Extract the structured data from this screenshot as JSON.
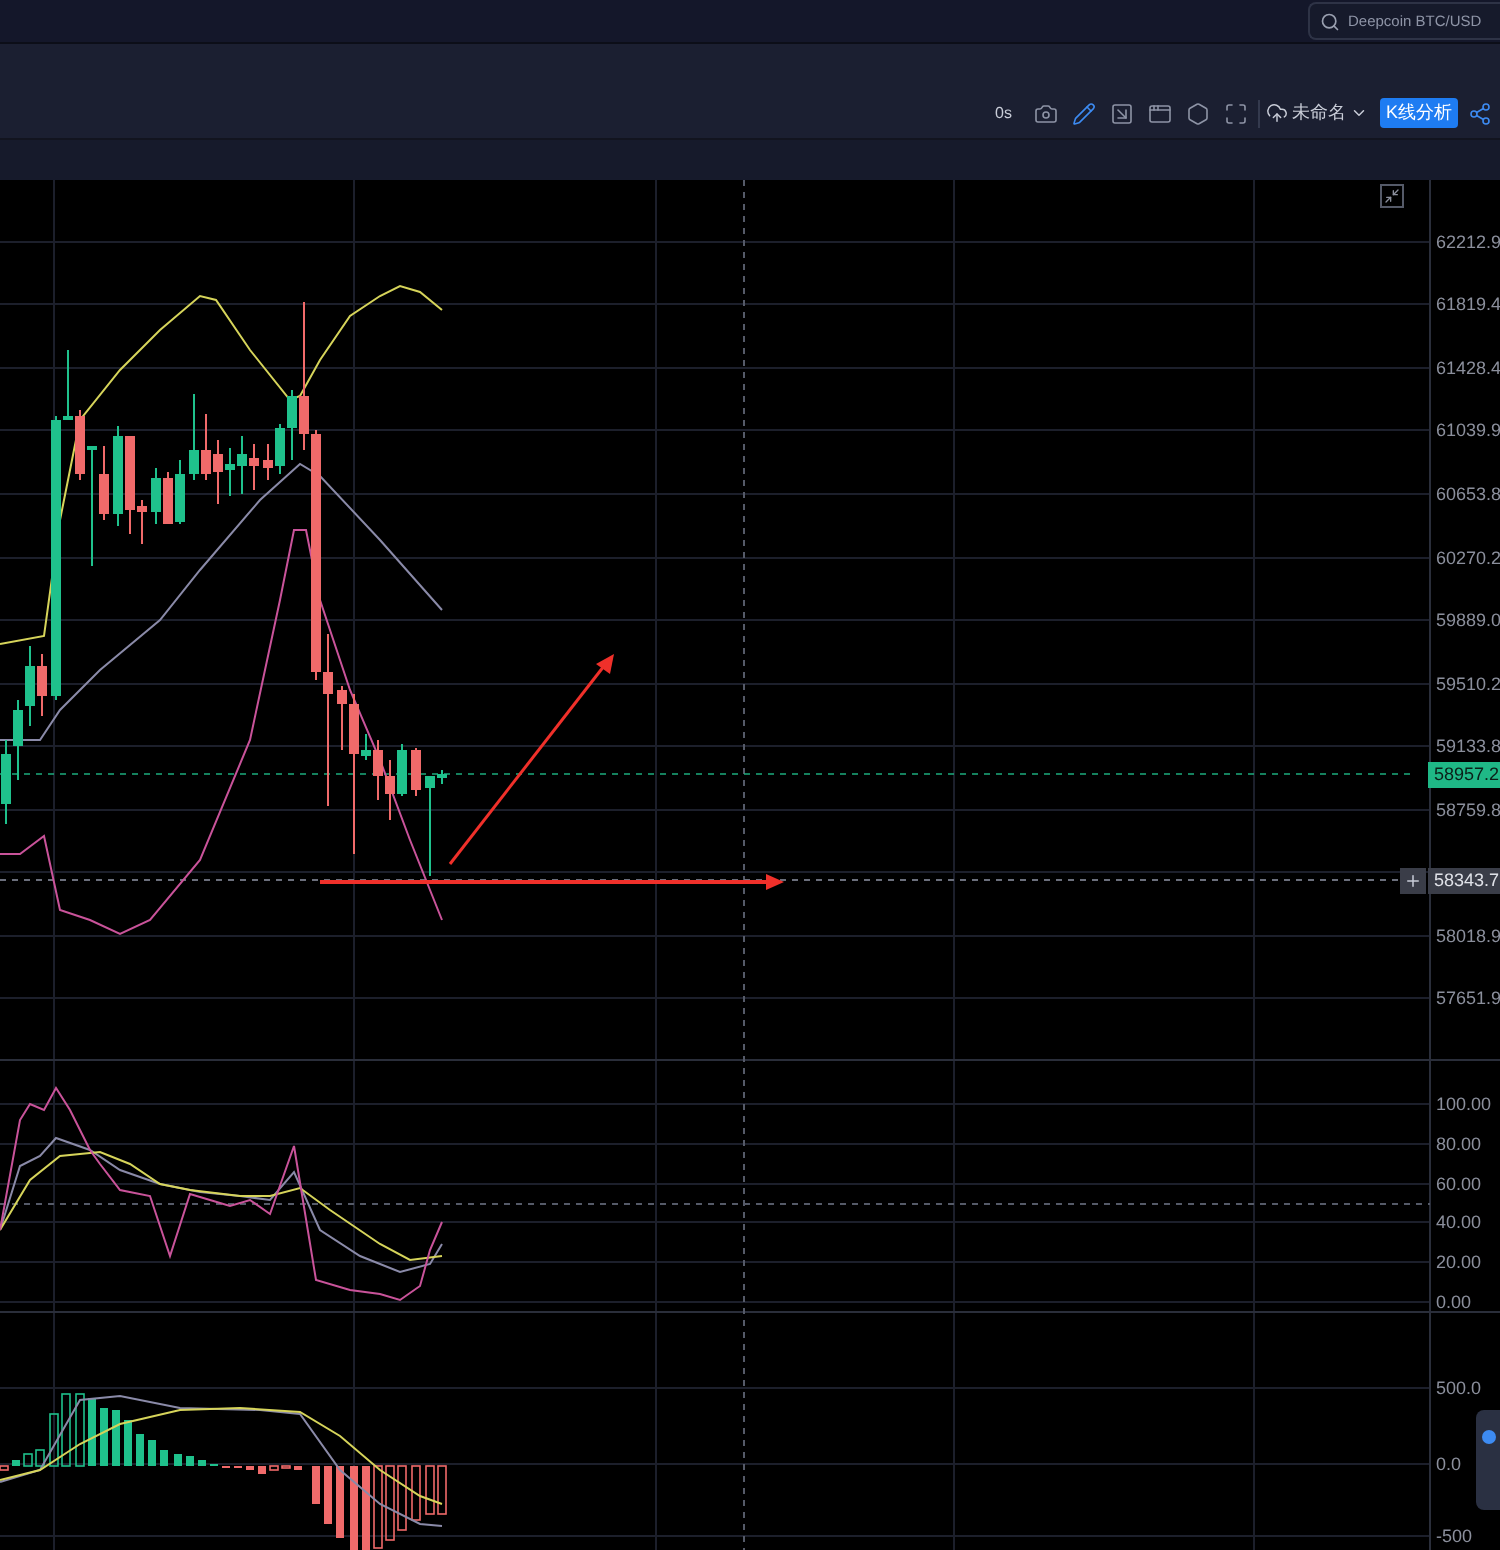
{
  "search": {
    "value": "Deepcoin BTC/USD"
  },
  "toolbar": {
    "interval": "0s",
    "layout_name": "未命名",
    "analysis_button": "K线分析"
  },
  "price_axis": [
    "62212.9",
    "61819.4",
    "61428.4",
    "61039.9",
    "60653.8",
    "60270.2",
    "59889.0",
    "59510.2",
    "59133.8",
    "58759.8",
    "58018.9",
    "57651.9"
  ],
  "last_price": "58957.2",
  "crosshair_price": "58343.7",
  "oscillator_axis": [
    "100.00",
    "80.00",
    "60.00",
    "40.00",
    "20.00",
    "0.00"
  ],
  "macd_axis": [
    "500.0",
    "0.0",
    "-500"
  ]
}
